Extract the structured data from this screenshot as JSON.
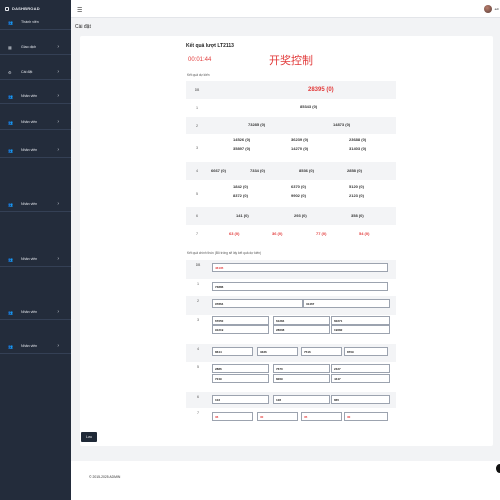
{
  "brand": "DASHBROAD",
  "sidebar": {
    "items": [
      {
        "icon": "users-icon",
        "glyph": "👥",
        "label": "Thành viên",
        "chevron": false
      },
      {
        "icon": "cart-icon",
        "glyph": "▦",
        "label": "Giao dịch",
        "chevron": true
      },
      {
        "icon": "gear-icon",
        "glyph": "⚙",
        "label": "Cài đặt",
        "chevron": true
      },
      {
        "icon": "users-icon",
        "glyph": "👥",
        "label": "Nhân viên",
        "chevron": true
      },
      {
        "icon": "users-icon",
        "glyph": "👥",
        "label": "Nhân viên",
        "chevron": true
      },
      {
        "icon": "users-icon",
        "glyph": "👥",
        "label": "Nhân viên",
        "chevron": true
      },
      {
        "icon": "users-icon",
        "glyph": "👥",
        "label": "Nhân viên",
        "chevron": true
      },
      {
        "icon": "users-icon",
        "glyph": "👥",
        "label": "Nhân viên",
        "chevron": true
      },
      {
        "icon": "users-icon",
        "glyph": "👥",
        "label": "Nhân viên",
        "chevron": true
      },
      {
        "icon": "users-icon",
        "glyph": "👥",
        "label": "Nhân viên",
        "chevron": true
      }
    ]
  },
  "header": {
    "user_name": "adr"
  },
  "page_title": "Cài đặt",
  "result": {
    "title": "Kết quả lượt LT2113",
    "countdown": "00:01:44",
    "watermark": "开奖控制",
    "predicted_label": "Kết quả dự kiến",
    "official_label": "Kết quả chính thức (Bỏ trống sẽ lấy kết quả dự kiến)",
    "accent_color": "#e23a3a"
  },
  "predicted": [
    {
      "prize": "DB",
      "numbers": [
        "28395 (0)"
      ]
    },
    {
      "prize": "1",
      "numbers": [
        "85343 (0)"
      ]
    },
    {
      "prize": "2",
      "numbers": [
        "73285 (0)",
        "14873 (0)"
      ]
    },
    {
      "prize": "3",
      "numbers": [
        "14526 (0)",
        "36239 (0)",
        "23688 (0)",
        "35897 (0)",
        "14270 (0)",
        "31403 (0)"
      ]
    },
    {
      "prize": "4",
      "numbers": [
        "6667 (0)",
        "7334 (0)",
        "8536 (0)",
        "2858 (0)"
      ]
    },
    {
      "prize": "5",
      "numbers": [
        "1842 (0)",
        "6370 (0)",
        "5120 (0)",
        "8372 (0)",
        "9902 (0)",
        "2123 (0)"
      ]
    },
    {
      "prize": "6",
      "numbers": [
        "141 (0)",
        "293 (0)",
        "358 (0)"
      ]
    },
    {
      "prize": "7",
      "numbers": [
        "63 (0)",
        "36 (0)",
        "77 (0)",
        "54 (0)"
      ]
    }
  ],
  "official": [
    {
      "prize": "DB",
      "values": [
        "46135"
      ]
    },
    {
      "prize": "1",
      "values": [
        "73886"
      ]
    },
    {
      "prize": "2",
      "values": [
        "97864",
        "31467"
      ]
    },
    {
      "prize": "3",
      "values": [
        "67650",
        "61284",
        "60271",
        "91219",
        "28608",
        "19682"
      ]
    },
    {
      "prize": "4",
      "values": [
        "8644",
        "3336",
        "7516",
        "8709"
      ]
    },
    {
      "prize": "5",
      "values": [
        "2886",
        "7670",
        "2427",
        "7249",
        "8269",
        "4447"
      ]
    },
    {
      "prize": "6",
      "values": [
        "103",
        "128",
        "865"
      ]
    },
    {
      "prize": "7",
      "values": [
        "36",
        "30",
        "35",
        "30"
      ]
    }
  ],
  "save_label": "Lưu",
  "footer": "© 2015-2025 ADMIN"
}
